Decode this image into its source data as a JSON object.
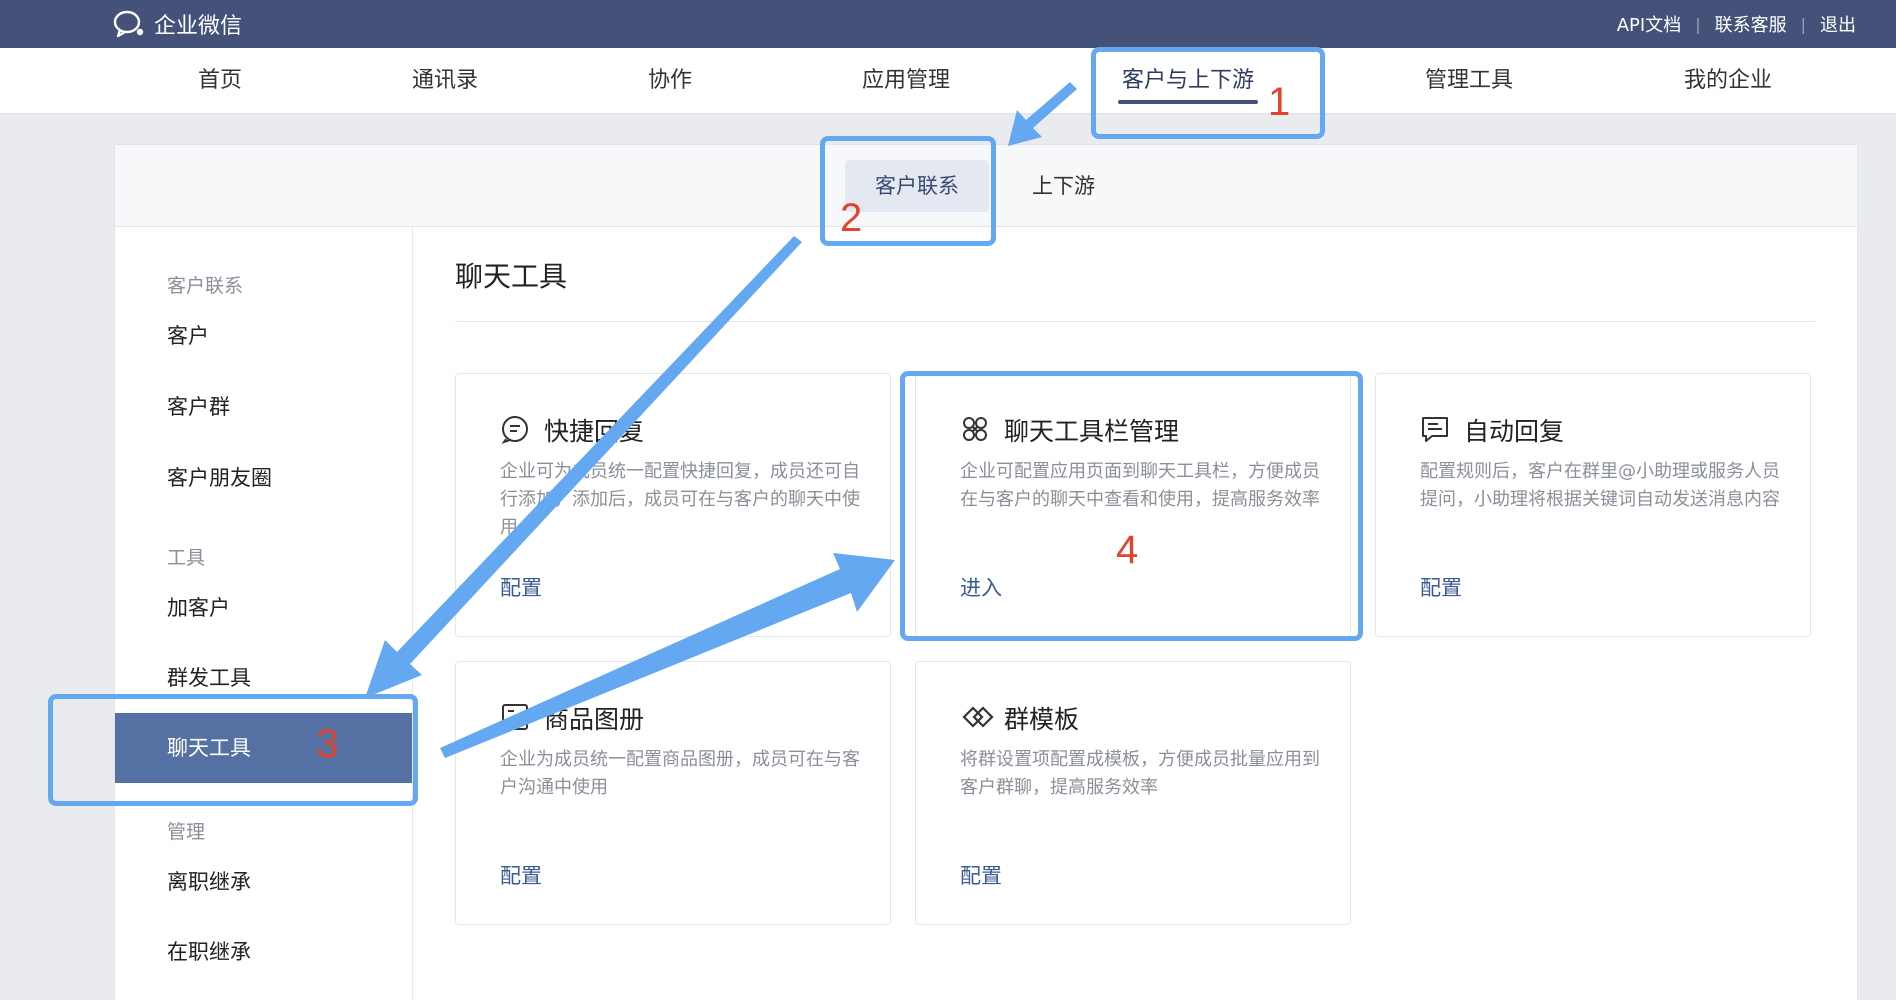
{
  "header": {
    "logo_text": "企业微信",
    "links": [
      "API文档",
      "联系客服",
      "退出"
    ]
  },
  "nav": {
    "items": [
      "首页",
      "通讯录",
      "协作",
      "应用管理",
      "客户与上下游",
      "管理工具",
      "我的企业"
    ],
    "active_index": 4
  },
  "subnav": {
    "tabs": [
      "客户联系",
      "上下游"
    ],
    "active_index": 0
  },
  "sidebar": {
    "groups": [
      {
        "title": "客户联系",
        "items": [
          "客户",
          "客户群",
          "客户朋友圈"
        ]
      },
      {
        "title": "工具",
        "items": [
          "加客户",
          "群发工具",
          "聊天工具"
        ]
      },
      {
        "title": "管理",
        "items": [
          "离职继承",
          "在职继承"
        ]
      }
    ],
    "active_item": "聊天工具"
  },
  "content": {
    "title": "聊天工具",
    "cards": [
      {
        "icon": "quick-reply-icon",
        "title": "快捷回复",
        "desc": "企业可为成员统一配置快捷回复，成员还可自行添加，添加后，成员可在与客户的聊天中使用",
        "action": "配置"
      },
      {
        "icon": "toolbar-manage-icon",
        "title": "聊天工具栏管理",
        "desc": "企业可配置应用页面到聊天工具栏，方便成员在与客户的聊天中查看和使用，提高服务效率",
        "action": "进入"
      },
      {
        "icon": "auto-reply-icon",
        "title": "自动回复",
        "desc": "配置规则后，客户在群里@小助理或服务人员提问，小助理将根据关键词自动发送消息内容",
        "action": "配置"
      },
      {
        "icon": "product-album-icon",
        "title": "商品图册",
        "desc": "企业为成员统一配置商品图册，成员可在与客户沟通中使用",
        "action": "配置"
      },
      {
        "icon": "group-template-icon",
        "title": "群模板",
        "desc": "将群设置项配置成模板，方便成员批量应用到客户群聊，提高服务效率",
        "action": "配置"
      }
    ]
  },
  "annotations": {
    "step_numbers": [
      "1",
      "2",
      "3",
      "4"
    ],
    "highlight_color": "#63a8f0",
    "number_color": "#e0442c"
  },
  "colors": {
    "topbar": "#44527a",
    "active_sidebar": "#5570a3",
    "link": "#3a5a96"
  }
}
